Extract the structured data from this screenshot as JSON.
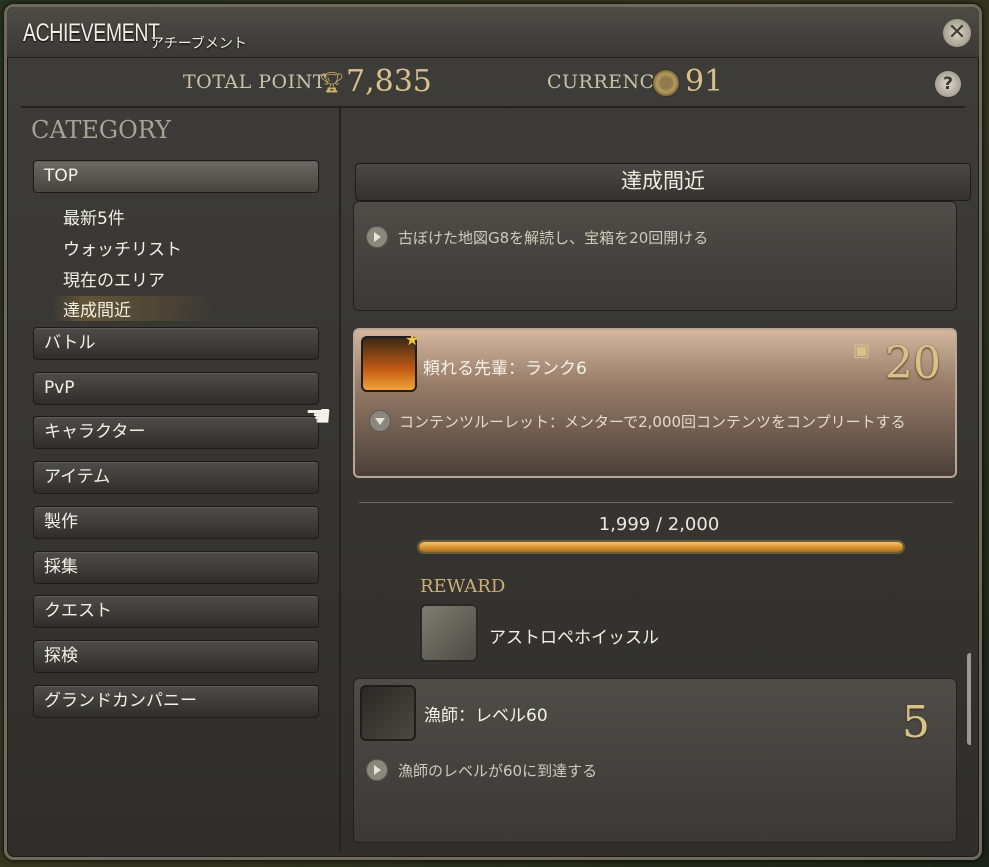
{
  "window": {
    "title": "ACHIEVEMENT",
    "subtitle": "アチーブメント",
    "close_icon": "close-icon",
    "help_label": "?"
  },
  "points": {
    "total_label": "TOTAL POINT",
    "total_value": "7,835",
    "currency_label": "CURRENCY",
    "currency_value": "91"
  },
  "sidebar": {
    "heading": "CATEGORY",
    "top_label": "TOP",
    "sub_items": [
      "最新5件",
      "ウォッチリスト",
      "現在のエリア",
      "達成間近"
    ],
    "selected_sub_item": "達成間近",
    "categories": [
      "バトル",
      "PvP",
      "キャラクター",
      "アイテム",
      "製作",
      "採集",
      "クエスト",
      "探検",
      "グランドカンパニー"
    ]
  },
  "main": {
    "section_title": "達成間近",
    "achievements": [
      {
        "name": "",
        "description": "古ぼけた地図G8を解読し、宝箱を20回開ける",
        "points": ""
      },
      {
        "name": "頼れる先輩：ランク6",
        "description": "コンテンツルーレット：メンターで2,000回コンテンツをコンプリートする",
        "points": "20",
        "expanded": true,
        "progress_text": "1,999 / 2,000",
        "progress_fraction": 0.9995,
        "reward_label": "REWARD",
        "reward_item": "アストロペホイッスル"
      },
      {
        "name": "漁師：レベル60",
        "description": "漁師のレベルが60に到達する",
        "points": "5"
      }
    ]
  },
  "colors": {
    "gold": "#d9c28a",
    "progress": "#d48f2c",
    "highlight": "#d3b79f"
  }
}
